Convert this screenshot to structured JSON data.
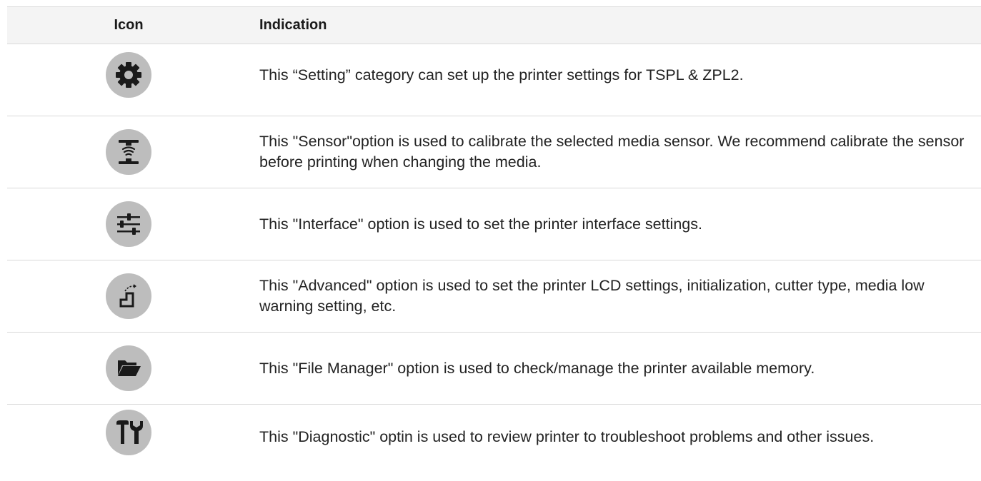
{
  "table": {
    "headers": {
      "icon": "Icon",
      "indication": "Indication"
    },
    "rows": [
      {
        "icon": "gear-icon",
        "text": "This “Setting” category can set up the printer settings for TSPL & ZPL2."
      },
      {
        "icon": "sensor-icon",
        "text": "This \"Sensor\"option is used to calibrate the selected media sensor. We recommend calibrate the sensor before printing when changing the media."
      },
      {
        "icon": "sliders-icon",
        "text": "This \"Interface\" option is used to set the printer interface settings."
      },
      {
        "icon": "stairs-arrow-icon",
        "text": "This \"Advanced\" option is used to set the printer LCD settings, initialization, cutter type, media low warning setting, etc."
      },
      {
        "icon": "folder-open-icon",
        "text": "This \"File Manager\" option is used to check/manage the printer available memory."
      },
      {
        "icon": "tools-icon",
        "text": "This \"Diagnostic\" optin is used to review printer to troubleshoot problems and other issues."
      }
    ]
  },
  "colors": {
    "icon_background": "#bdbdbd",
    "icon_glyph": "#1a1a1a",
    "header_background": "#f4f4f4",
    "border": "#d9d9d9"
  }
}
